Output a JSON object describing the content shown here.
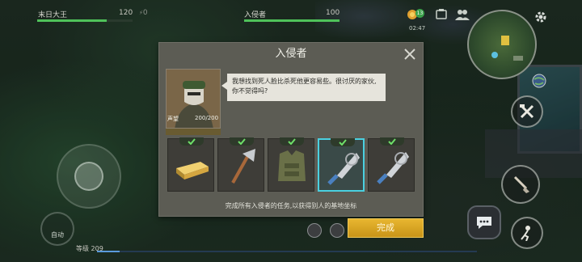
{
  "hud": {
    "player_name": "末日大王",
    "player_hp": "120",
    "player_hp_fraction": 0.73,
    "player_extra": "0",
    "target_name": "入侵者",
    "target_hp": "100",
    "target_hp_fraction": 1.0,
    "time": "02:47",
    "badge_count": "13"
  },
  "dialog": {
    "title": "入侵者",
    "npc_name": "声望",
    "npc_progress": "200/200",
    "speech": "我想找到死人脸比杀死他更容易些。很讨厌的家伙,你不觉得吗?",
    "rewards": [
      {
        "item": "gold-bars",
        "completed": true
      },
      {
        "item": "hatchet",
        "completed": true
      },
      {
        "item": "armor-vest",
        "completed": true
      },
      {
        "item": "machete-blade",
        "completed": true,
        "selected": true
      },
      {
        "item": "machete-blade",
        "completed": true
      }
    ],
    "hint": "完成所有入侵者的任务,以获得别人的基地坐标",
    "complete_label": "完成"
  },
  "controls": {
    "auto_label": "自动",
    "level_label": "等级 209"
  },
  "colors": {
    "hp_green": "#4fc25a",
    "accent_gold": "#e8b630",
    "selected_cyan": "#4ad0e0",
    "panel_bg": "#5c5c54"
  }
}
